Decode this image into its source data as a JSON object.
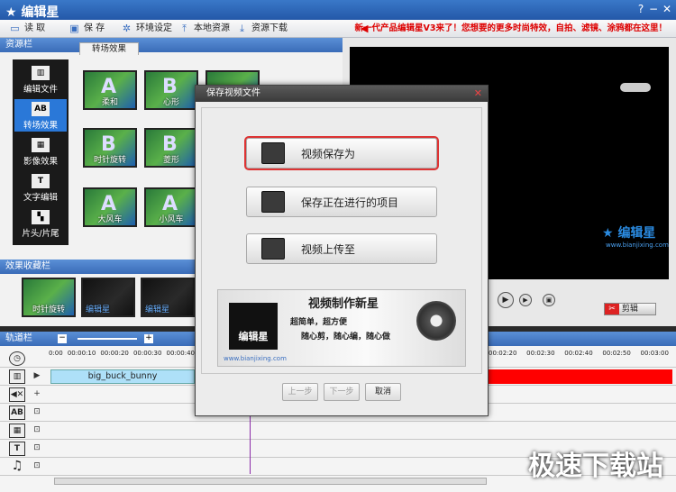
{
  "app": {
    "title": "编辑星"
  },
  "window_controls": {
    "help": "?",
    "minimize": "−",
    "close": "✕"
  },
  "toolbar": {
    "items": [
      {
        "label": "读  取",
        "icon": "folder-open-icon"
      },
      {
        "label": "保  存",
        "icon": "save-icon"
      },
      {
        "label": "环境设定",
        "icon": "gear-icon"
      },
      {
        "label": "本地资源",
        "icon": "upload-icon"
      },
      {
        "label": "资源下载",
        "icon": "download-icon"
      }
    ],
    "promo": "新一代产品编辑星V3来了！您想要的更多时尚特效，自拍、滤镜、涂鸦都在这里！"
  },
  "resources": {
    "header": "资源栏",
    "active_tab": "转场效果",
    "sidebar": [
      {
        "label": "编辑文件",
        "icon": "film-icon"
      },
      {
        "label": "转场效果",
        "icon": "ab-icon"
      },
      {
        "label": "影像效果",
        "icon": "image-icon"
      },
      {
        "label": "文字编辑",
        "icon": "text-icon"
      },
      {
        "label": "片头/片尾",
        "icon": "title-icon"
      }
    ],
    "transitions": [
      {
        "label": "柔和",
        "letter": "A"
      },
      {
        "label": "心形",
        "letter": "B"
      },
      {
        "label": "",
        "letter": ""
      },
      {
        "label": "时针旋转",
        "letter": "B"
      },
      {
        "label": "菱形",
        "letter": "B"
      },
      {
        "label": "",
        "letter": ""
      },
      {
        "label": "大风车",
        "letter": "A"
      },
      {
        "label": "小风车",
        "letter": "A"
      }
    ]
  },
  "favorites": {
    "header": "效果收藏栏",
    "items": [
      {
        "label": "时针旋转"
      },
      {
        "label": "编辑星"
      },
      {
        "label": "编辑星"
      }
    ]
  },
  "player": {
    "watermark": "编辑星",
    "watermark_url": "www.bianjixing.com",
    "cut_label": "剪辑"
  },
  "track": {
    "header": "轨道栏",
    "ruler_left": [
      "0:00",
      "00:00:10",
      "00:00:20",
      "00:00:30",
      "00:00:40"
    ],
    "ruler_right": [
      "00:02:20",
      "00:02:30",
      "00:02:40",
      "00:02:50",
      "00:03:00"
    ],
    "clip_name": "big_buck_bunny"
  },
  "dialog": {
    "title": "保存视频文件",
    "buttons": [
      {
        "label": "视频保存为",
        "icon": "floppy-icon"
      },
      {
        "label": "保存正在进行的项目",
        "icon": "film-strip-icon"
      },
      {
        "label": "视频上传至",
        "icon": "upload-icon"
      }
    ],
    "banner": {
      "logo": "编辑星",
      "headline": "视频制作新星",
      "line1": "超简单，超方便",
      "line2": "随心剪，随心编，随心做",
      "url": "www.bianjixing.com"
    },
    "prev": "上一步",
    "next": "下一步",
    "cancel": "取消"
  },
  "site_watermark": "极速下载站"
}
